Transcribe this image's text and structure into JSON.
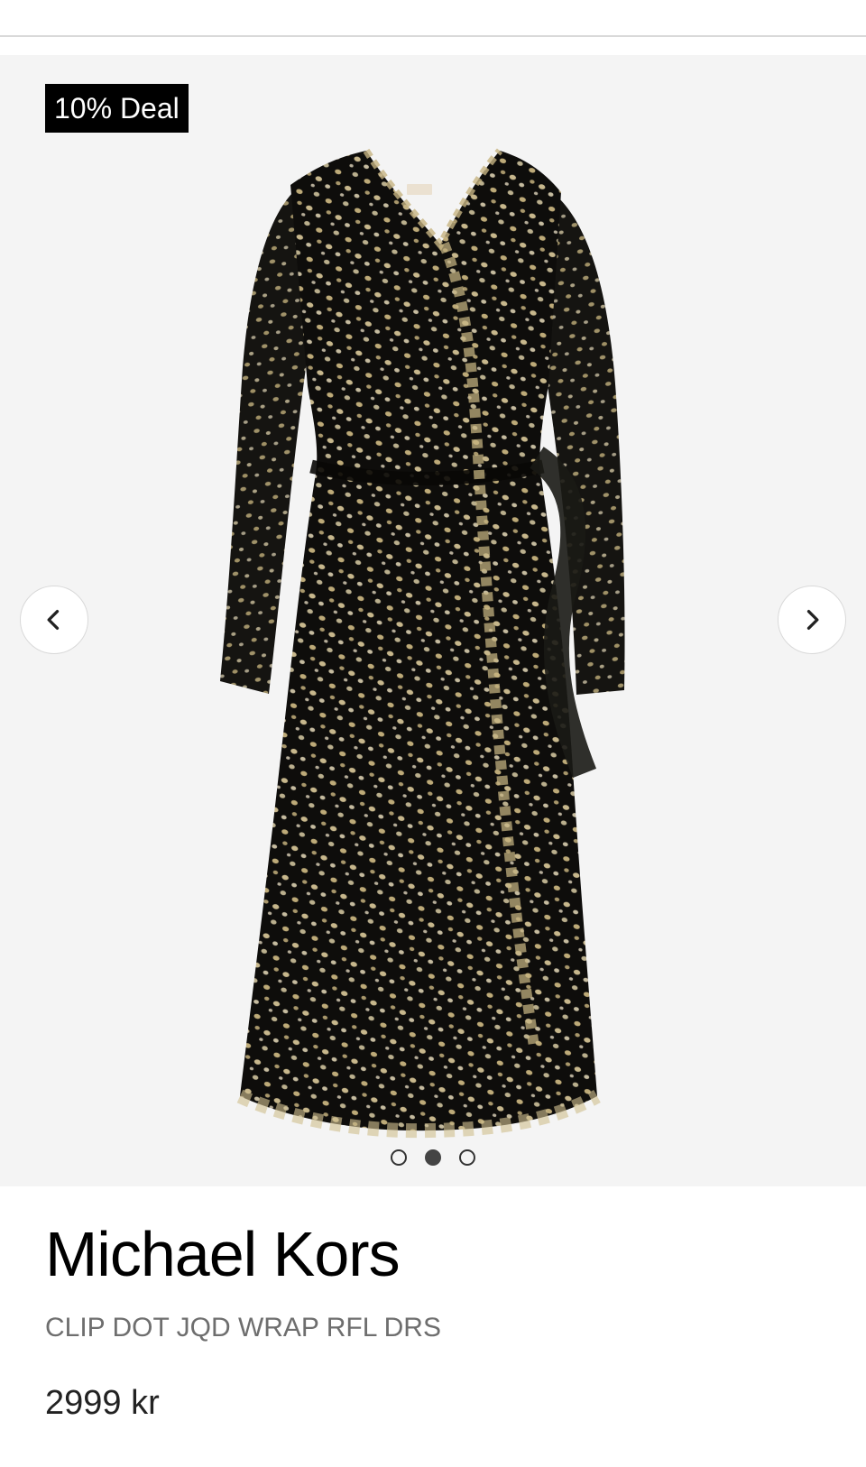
{
  "gallery": {
    "badge_text": "10% Deal",
    "prev_icon": "chevron-left-icon",
    "next_icon": "chevron-right-icon",
    "slide_count": 3,
    "active_slide": 2,
    "image_subject": "black and gold clip dot wrap dress",
    "colors": {
      "background": "#f4f4f4",
      "badge_bg": "#000000",
      "badge_text": "#ffffff",
      "dress_base": "#0e0d0b",
      "dress_dots": "#c9b889"
    }
  },
  "product": {
    "brand": "Michael Kors",
    "name": "CLIP DOT JQD WRAP RFL DRS",
    "price": "2999 kr"
  }
}
